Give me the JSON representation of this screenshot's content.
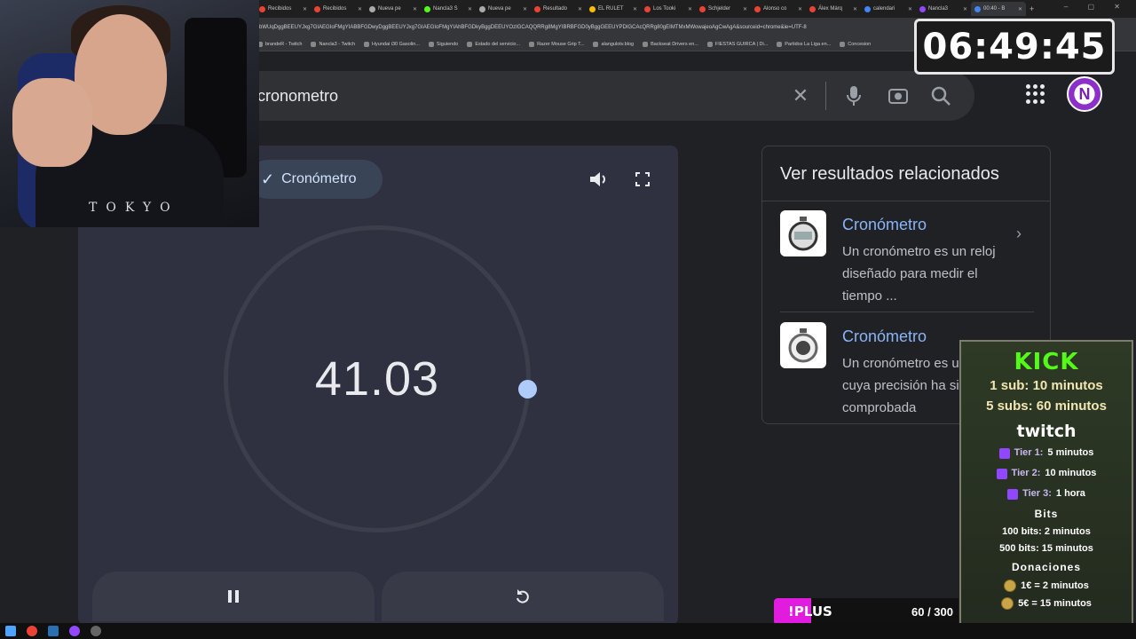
{
  "browser": {
    "tabs": [
      {
        "label": "Recibidos",
        "color": "#ea4335"
      },
      {
        "label": "Recibidos",
        "color": "#ea4335"
      },
      {
        "label": "Nueva pe",
        "color": "#aaaaaa"
      },
      {
        "label": "Nancla3 S",
        "color": "#53fc18"
      },
      {
        "label": "Nueva pe",
        "color": "#aaaaaa"
      },
      {
        "label": "Resultado",
        "color": "#ea4335"
      },
      {
        "label": "EL RULET",
        "color": "#fbbc04"
      },
      {
        "label": "Los Tooki",
        "color": "#ea4335"
      },
      {
        "label": "Schjelder",
        "color": "#ea4335"
      },
      {
        "label": "Alonso co",
        "color": "#ea4335"
      },
      {
        "label": "Álex Márq",
        "color": "#ea4335"
      },
      {
        "label": "calendari",
        "color": "#4285f4"
      },
      {
        "label": "Nancla3",
        "color": "#9146ff"
      },
      {
        "label": "00:40 - B",
        "color": "#4285f4"
      }
    ],
    "url": "bWUqDggBEEUYJxg7GIAEGIoFMgYIABBFGDwyDggBEEUYJxg7GIAEGIoFMgYIAhBFGDkyBggDEEUYOzIGCAQQRRg8MgYIBRBFGD0yBggGEEUYPDIGCAcQRRg80gEIMTMxMWowajeoAgCwAgA&sourceid=chrome&ie=UTF-8",
    "bookmarks": [
      "brandeR - Twitch",
      "Nancla3 - Twitch",
      "Hyundai i30 Gasolin...",
      "Siguiendo",
      "Estado del servicio...",
      "Razer Mouse Grip T...",
      "alangulotv.blog",
      "Backseat Drivers en...",
      "FIESTAS GUIRCA | Di...",
      "Partidos La Liga en...",
      "Concesion"
    ]
  },
  "search": {
    "query": "cronometro"
  },
  "stopwatch": {
    "chip_label": "Cronómetro",
    "time": "41.03"
  },
  "related": {
    "title": "Ver resultados relacionados",
    "items": [
      {
        "name": "Cronómetro",
        "desc": "Un cronómetro es un reloj diseñado para medir el tiempo ..."
      },
      {
        "name": "Cronómetro",
        "desc": "Un cronómetro es un reloj cuya precisión ha sido comprobada"
      }
    ]
  },
  "overlay": {
    "timer": "06:49:45",
    "webcam_shirt": "TOKYO",
    "kick_logo": "KICK",
    "kick_lines": [
      "1 sub: 10 minutos",
      "5 subs: 60 minutos"
    ],
    "twitch_logo": "twitch",
    "tiers": [
      {
        "name": "Tier 1:",
        "value": "5 minutos"
      },
      {
        "name": "Tier 2:",
        "value": "10 minutos"
      },
      {
        "name": "Tier 3:",
        "value": "1 hora"
      }
    ],
    "bits_heading": "Bits",
    "bits_lines": [
      "100 bits: 2 minutos",
      "500 bits: 15 minutos"
    ],
    "donations_heading": "Donaciones",
    "donations_lines": [
      "1€ = 2 minutos",
      "5€ = 15 minutos"
    ],
    "plus_label": "!PLUS",
    "plus_count": "60 / 300",
    "plus_progress": 0.2
  },
  "colors": {
    "accent_blue": "#8ab4f8",
    "kick_green": "#53fc18",
    "twitch_purple": "#9146ff",
    "plus_magenta": "#e21cde"
  }
}
